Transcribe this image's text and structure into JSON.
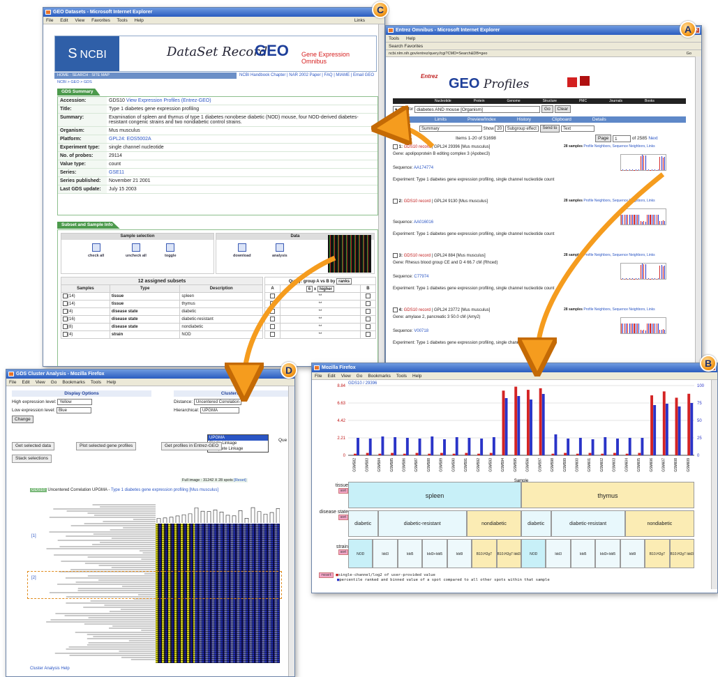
{
  "badges": {
    "a": "A",
    "b": "B",
    "c": "C",
    "d": "D"
  },
  "winC": {
    "title": "GEO Datasets - Microsoft Internet Explorer",
    "menu": [
      "File",
      "Edit",
      "View",
      "Favorites",
      "Tools",
      "Help"
    ],
    "links_label": "Links",
    "ncbi": "NCBI",
    "dataset_record": "DataSet Record",
    "geo_logo": "GEO",
    "geo_sub": "Gene Expression Omnibus",
    "top_links": "NCBI Handbook Chapter | NAR 2002 Paper | FAQ | MIAME | Email GEO",
    "nav": "HOME · SEARCH · SITE MAP",
    "crumb": "NCBI > GEO > GDS",
    "summary_tab": "GDS Summary",
    "summary": [
      {
        "k": "Accession:",
        "v": "GDS10",
        "link": "View Expression Profiles (Entrez-GEO)"
      },
      {
        "k": "Title:",
        "v": "Type 1 diabetes gene expression profiling"
      },
      {
        "k": "Summary:",
        "v": "Examination of spleen and thymus of type 1 diabetes nonobese diabetic (NOD) mouse, four NOD-derived diabetes-resistant congenic strains and two nondiabetic control strains."
      },
      {
        "k": "Organism:",
        "v": "Mus musculus"
      },
      {
        "k": "Platform:",
        "v": "GPL24: EOS5002A"
      },
      {
        "k": "Experiment type:",
        "v": "single channel nucleotide"
      },
      {
        "k": "No. of probes:",
        "v": "29114"
      },
      {
        "k": "Value type:",
        "v": "count"
      },
      {
        "k": "Series:",
        "v": "GSE11"
      },
      {
        "k": "Series published:",
        "v": "November 21 2001"
      },
      {
        "k": "Last GDS update:",
        "v": "July 15 2003"
      }
    ],
    "subset_tab": "Subset and Sample Info",
    "sample_selection": "Sample selection",
    "data_label": "Data",
    "check_all": "check all",
    "uncheck_all": "uncheck all",
    "toggle": "toggle",
    "download": "download",
    "analysis": "analysis",
    "assigned": "12 assigned subsets",
    "cols": [
      "Samples",
      "Type",
      "Description"
    ],
    "query": "Query: group A vs B by",
    "ranks": "ranks",
    "q_a": "A",
    "q_b": "B",
    "q_6": "6",
    "q_x": "x",
    "q_higher": "higher",
    "subsets": [
      {
        "n": "(14)",
        "type": "tissue",
        "desc": "spleen"
      },
      {
        "n": "(14)",
        "type": "tissue",
        "desc": "thymus"
      },
      {
        "n": "(4)",
        "type": "disease state",
        "desc": "diabetic"
      },
      {
        "n": "(16)",
        "type": "disease state",
        "desc": "diabetic-resistant"
      },
      {
        "n": "(8)",
        "type": "disease state",
        "desc": "nondiabetic"
      },
      {
        "n": "(4)",
        "type": "strain",
        "desc": "NOD"
      }
    ],
    "star": "**"
  },
  "winA": {
    "title": "Entrez Omnibus - Microsoft Internet Explorer",
    "menu": [
      "Tools",
      "Help"
    ],
    "toolbar": "Search   Favorites",
    "address": "ncbi.nlm.nih.gov/entrez/query.fcgi?CMD=Search&DB=geo",
    "go": "Go",
    "links": "Links",
    "entrez": "Entrez",
    "geo": "GEO",
    "profiles": "Profiles",
    "nav": [
      "Nucleotide",
      "Protein",
      "Genome",
      "Structure",
      "PMC",
      "Journals",
      "Books"
    ],
    "query": "diabetes AND mouse [Organism]",
    "for_label": "for",
    "go_btn": "Go",
    "clear_btn": "Clear",
    "tabs": [
      "Limits",
      "Preview/Index",
      "History",
      "Clipboard",
      "Details"
    ],
    "display": "Summary",
    "show_label": "Show",
    "show": "20",
    "subgroup": "Subgroup effect",
    "send_to": "Send to",
    "text": "Text",
    "items": "Items 1-20 of 51698",
    "page_label": "Page",
    "page": "1",
    "of_pages": "of 2585",
    "next": "Next",
    "results": [
      {
        "num": "1:",
        "rec": "GDS10 record",
        "plat": "GPL24 29396 [Mus musculus]",
        "gene": "apolipoprotein B editing complex 3 (Apobec3)",
        "seq": "AA174774",
        "exp": "Type 1 diabetes gene expression profiling, single channel nucleotide count"
      },
      {
        "num": "2:",
        "rec": "GDS10 record",
        "plat": "GPL24 9130 [Mus musculus]",
        "gene": "",
        "seq": "AA016016",
        "exp": "Type 1 diabetes gene expression profiling, single channel nucleotide count"
      },
      {
        "num": "3:",
        "rec": "GDS10 record",
        "plat": "GPL24 884 [Mus musculus]",
        "gene": "Rhesus blood group CE and D 4 66.7 cM (Rhced)",
        "seq": "C77974",
        "exp": "Type 1 diabetes gene expression profiling, single channel nucleotide count"
      },
      {
        "num": "4:",
        "rec": "GDS10 record",
        "plat": "GPL24 23772 [Mus musculus]",
        "gene": "amylase 2, pancreatic 3 50.0 cM (Amy2)",
        "seq": "V00718",
        "exp": "Type 1 diabetes gene expression profiling, single channel nucleotide count"
      }
    ],
    "samples": "28 samples",
    "neighbors": "Profile Neighbors, Sequence Neighbors, Links",
    "gene_label": "Gene:",
    "seq_label": "Sequence:",
    "exp_label": "Experiment:"
  },
  "winD": {
    "title": "GDS Cluster Analysis - Mozilla Firefox",
    "menu": [
      "File",
      "Edit",
      "View",
      "Go",
      "Bookmarks",
      "Tools",
      "Help"
    ],
    "display_options": "Display Options",
    "clustering": "Clustering",
    "high_label": "High expression level:",
    "high": "Yellow",
    "low_label": "Low expression level:",
    "low": "Blue",
    "change": "Change",
    "distance_label": "Distance:",
    "distance": "Uncentered Correlation",
    "hier_label": "Hierarchical:",
    "hier": "UPGMA",
    "dd": [
      "UPGMA",
      "Single Linkage",
      "Complete Linkage"
    ],
    "get_selected": "Get selected data",
    "plot_selected": "Plot selected gene profiles",
    "get_profiles": "Get profiles in Entrez-GEO",
    "stack": "Stack selections",
    "full_image": "Full image : 31242 X 28 spots",
    "reset": "[Reset]",
    "gds": "GDS10",
    "gds_desc": "Uncentered Correlation UPGMA -",
    "gds_link": "Type 1 diabetes gene expression profiling [Mus musculus]",
    "m1": "[1]",
    "m2": "[2]",
    "que": "Que",
    "help": "Cluster Analysis Help"
  },
  "winB": {
    "title": "Mozilla Firefox",
    "menu": [
      "File",
      "Edit",
      "View",
      "Go",
      "Bookmarks",
      "Tools",
      "Help"
    ],
    "gds_label": "GDS10 / 29396",
    "tissue_label": "tissue",
    "disease_label": "disease state",
    "strain_label": "strain",
    "sort": "sort",
    "reset": "reset",
    "legend1": "single-channel/log2 of user-provided value",
    "legend2": "percentile ranked and binned value of a spot compared to all other spots within that sample",
    "sample_axis": "Sample",
    "tissues": [
      "spleen",
      "thymus"
    ],
    "diseases": [
      "diabetic",
      "diabetic-resistant",
      "nondiabetic",
      "diabetic",
      "diabetic-resistant",
      "nondiabetic"
    ],
    "strains": [
      "NOD",
      "Idd3",
      "Idd5",
      "Idd3+Idd5",
      "Idd9",
      "B10.H2g7",
      "B10.H2g7 Idd3",
      "NOD",
      "Idd3",
      "Idd5",
      "Idd3+Idd5",
      "Idd9",
      "B10.H2g7",
      "B10.H2g7 Idd3"
    ]
  },
  "colors": {
    "red": "#d42424",
    "blue": "#2a34c8",
    "spleen": "#c8f0f8",
    "thymus": "#fbecb4",
    "accent": "#f59c1e"
  },
  "chart_data": {
    "type": "bar",
    "title": "GDS10 / 29396",
    "xlabel": "Sample",
    "ylabel": "",
    "ylim_left": [
      0,
      8.84
    ],
    "ylim_right": [
      0,
      100
    ],
    "yticks_left": [
      "0",
      "2.21",
      "4.42",
      "6.63",
      "8.84"
    ],
    "yticks_right": [
      "0",
      "25",
      "50",
      "75",
      "100"
    ],
    "categories": [
      "GSM582",
      "GSM583",
      "GSM584",
      "GSM585",
      "GSM586",
      "GSM587",
      "GSM588",
      "GSM589",
      "GSM590",
      "GSM591",
      "GSM592",
      "GSM593",
      "GSM594",
      "GSM595",
      "GSM596",
      "GSM597",
      "GSM598",
      "GSM599",
      "GSM600",
      "GSM601",
      "GSM602",
      "GSM603",
      "GSM604",
      "GSM605",
      "GSM606",
      "GSM607",
      "GSM608",
      "GSM609"
    ],
    "series": [
      {
        "name": "value",
        "values": [
          0.2,
          0.3,
          0.2,
          0.3,
          0.2,
          0.3,
          0.2,
          0.3,
          0.2,
          0.3,
          0.2,
          0.3,
          8.2,
          8.7,
          8.3,
          8.5,
          0.2,
          0.3,
          0.2,
          0.3,
          0.2,
          0.3,
          0.2,
          0.3,
          7.6,
          8.1,
          7.3,
          7.8
        ]
      },
      {
        "name": "rank",
        "values": [
          25,
          24,
          27,
          26,
          25,
          24,
          27,
          23,
          26,
          25,
          24,
          26,
          82,
          85,
          80,
          88,
          30,
          24,
          25,
          23,
          26,
          24,
          25,
          25,
          72,
          74,
          70,
          75
        ]
      }
    ]
  }
}
